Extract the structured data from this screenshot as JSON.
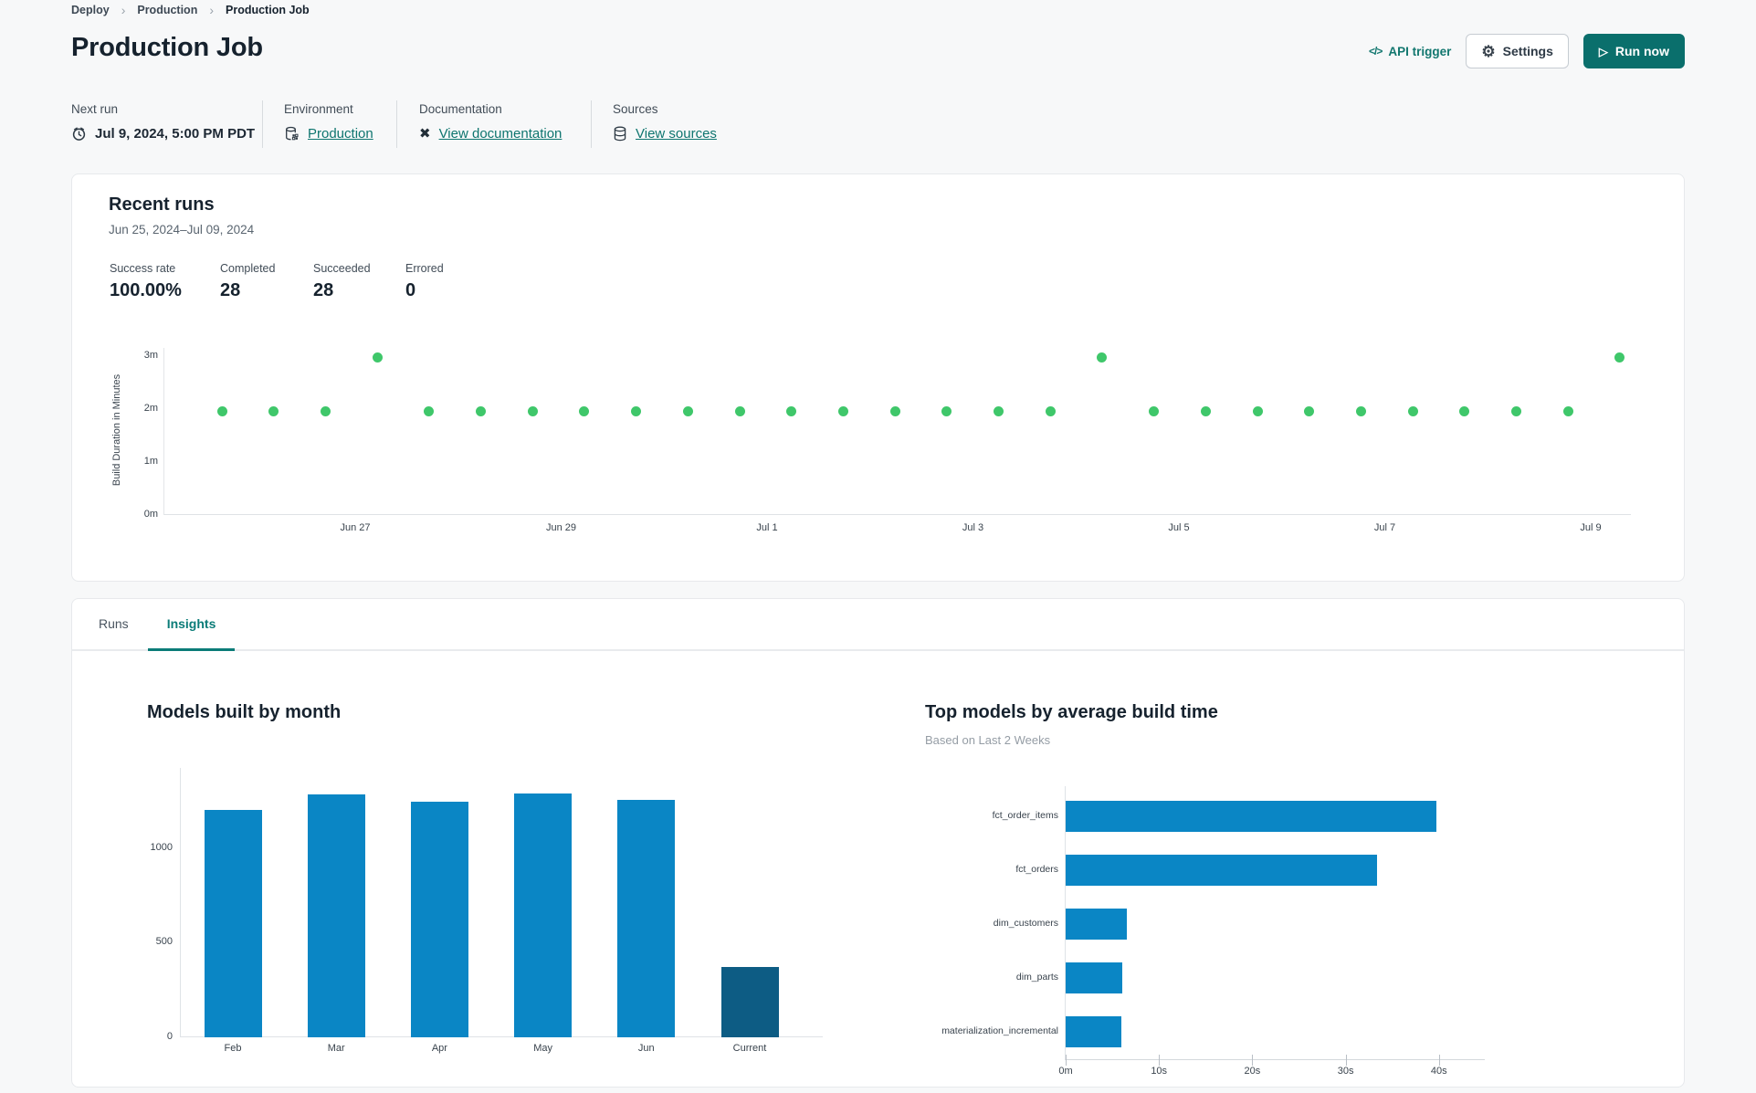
{
  "breadcrumb": {
    "separator": "›",
    "items": [
      {
        "label": "Deploy"
      },
      {
        "label": "Production"
      },
      {
        "label": "Production Job"
      }
    ]
  },
  "header": {
    "title": "Production Job",
    "api_trigger_icon": "</>",
    "api_trigger_label": "API trigger",
    "settings_label": "Settings",
    "run_now_label": "Run now",
    "gear_glyph": "⚙",
    "play_glyph": "▷",
    "docs_glyph": "✖"
  },
  "info": {
    "next_run": {
      "label": "Next run",
      "value": "Jul 9, 2024, 5:00 PM PDT"
    },
    "environment": {
      "label": "Environment",
      "link": "Production"
    },
    "documentation": {
      "label": "Documentation",
      "link": "View documentation"
    },
    "sources": {
      "label": "Sources",
      "link": "View sources"
    }
  },
  "recent_runs": {
    "title": "Recent runs",
    "date_range": "Jun 25, 2024–Jul 09, 2024",
    "stats": [
      {
        "label": "Success rate",
        "value": "100.00%"
      },
      {
        "label": "Completed",
        "value": "28"
      },
      {
        "label": "Succeeded",
        "value": "28"
      },
      {
        "label": "Errored",
        "value": "0"
      }
    ]
  },
  "tabs": [
    {
      "label": "Runs"
    },
    {
      "label": "Insights"
    }
  ],
  "active_tab": "Insights",
  "colors": {
    "accent_teal": "#0a6f6c",
    "link_teal": "#0e756f",
    "success_green": "#3fc76a",
    "bar_blue": "#0a86c5",
    "bar_navy": "#0d5c84"
  },
  "chart_data": [
    {
      "id": "run_durations",
      "type": "scatter",
      "ylabel": "Build Duration in Minutes",
      "y_ticks": [
        "3m",
        "2m",
        "1m",
        "0m"
      ],
      "ylim_minutes": [
        0,
        3.15
      ],
      "x_ticks": [
        "Jun 27",
        "Jun 29",
        "Jul 1",
        "Jul 3",
        "Jul 5",
        "Jul 7",
        "Jul 9"
      ],
      "points_minutes": [
        1.95,
        1.95,
        1.95,
        2.97,
        1.95,
        1.95,
        1.95,
        1.95,
        1.95,
        1.95,
        1.95,
        1.95,
        1.95,
        1.95,
        1.95,
        1.95,
        1.95,
        2.97,
        1.95,
        1.95,
        1.95,
        1.95,
        1.95,
        1.95,
        1.95,
        1.95,
        1.95,
        2.97
      ],
      "point_color": "#3fc76a",
      "legend": "none",
      "grid": false
    },
    {
      "id": "models_by_month",
      "type": "bar",
      "title": "Models built by month",
      "categories": [
        "Feb",
        "Mar",
        "Apr",
        "May",
        "Jun",
        "Current"
      ],
      "values": [
        1200,
        1285,
        1245,
        1290,
        1255,
        370
      ],
      "y_ticks": [
        0,
        500,
        1000
      ],
      "y_tick_labels": [
        "0",
        "500",
        "1000"
      ],
      "ylim": [
        0,
        1425
      ],
      "bar_color": "#0a86c5",
      "highlight_last_color": "#0d5c84",
      "grid": false
    },
    {
      "id": "top_models_by_avg_build_time",
      "type": "bar-horizontal",
      "title": "Top models by average build time",
      "subtitle": "Based on Last 2 Weeks",
      "categories": [
        "fct_order_items",
        "fct_orders",
        "dim_customers",
        "dim_parts",
        "materialization_incremental"
      ],
      "values_seconds": [
        39.7,
        33.4,
        6.6,
        6.1,
        6.0
      ],
      "x_ticks": [
        "0m",
        "10s",
        "20s",
        "30s",
        "40s"
      ],
      "x_tick_seconds": [
        0,
        10,
        20,
        30,
        40
      ],
      "xlim_seconds": [
        0,
        45
      ],
      "bar_color": "#0a86c5",
      "grid": false
    }
  ]
}
